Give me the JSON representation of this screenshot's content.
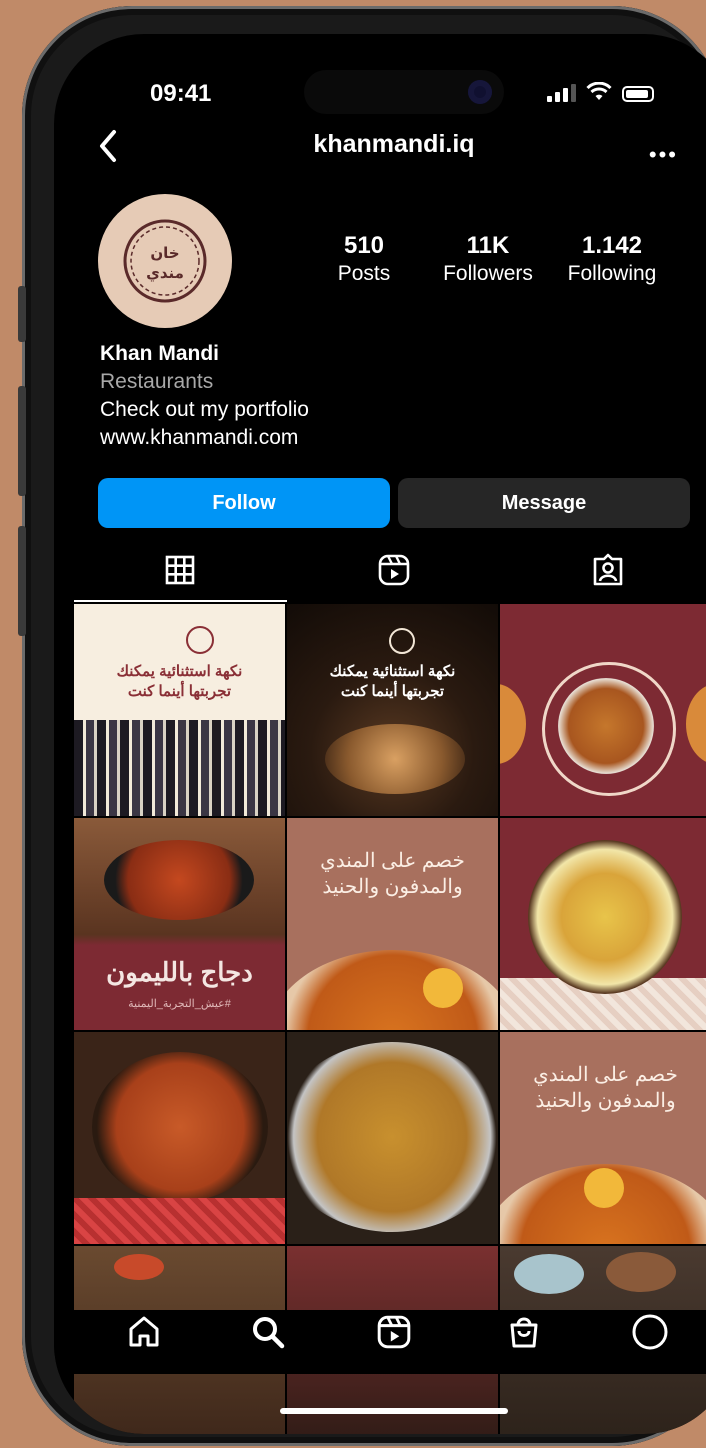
{
  "status_bar": {
    "time": "09:41"
  },
  "header": {
    "username": "khanmandi.iq"
  },
  "profile": {
    "avatar_text": "خان مندي",
    "stats": [
      {
        "value": "510",
        "label": "Posts"
      },
      {
        "value": "11K",
        "label": "Followers"
      },
      {
        "value": "1.142",
        "label": "Following"
      }
    ],
    "name": "Khan Mandi",
    "category": "Restaurants",
    "bio": "Check out my portfolio",
    "website": "www.khanmandi.com"
  },
  "actions": {
    "follow_label": "Follow",
    "message_label": "Message"
  },
  "tabs": [
    "grid-icon",
    "reels-icon",
    "tagged-icon"
  ],
  "posts": [
    {
      "caption": "نكهة استثنائية يمكنك\nتجربتها أينما كنت"
    },
    {
      "caption": "نكهة استثنائية يمكنك\nتجربتها أينما كنت"
    },
    {
      "caption": ""
    },
    {
      "caption": "دجاج بالليمون",
      "subcaption": "#عيش_التجربة_اليمنية"
    },
    {
      "caption": "خصم على المندي\nوالمدفون والحنيذ"
    },
    {
      "caption": ""
    },
    {
      "caption": ""
    },
    {
      "caption": ""
    },
    {
      "caption": "خصم على المندي\nوالمدفون والحنيذ"
    },
    {
      "caption": ""
    },
    {
      "caption": ""
    },
    {
      "caption": ""
    }
  ],
  "bottom_nav": [
    "home-icon",
    "search-icon",
    "reels-icon",
    "shop-icon",
    "profile-icon"
  ],
  "colors": {
    "follow_blue": "#0095f6",
    "message_gray": "#262626",
    "brand_maroon": "#7d2a33",
    "brand_beige": "#e6cbb6"
  }
}
